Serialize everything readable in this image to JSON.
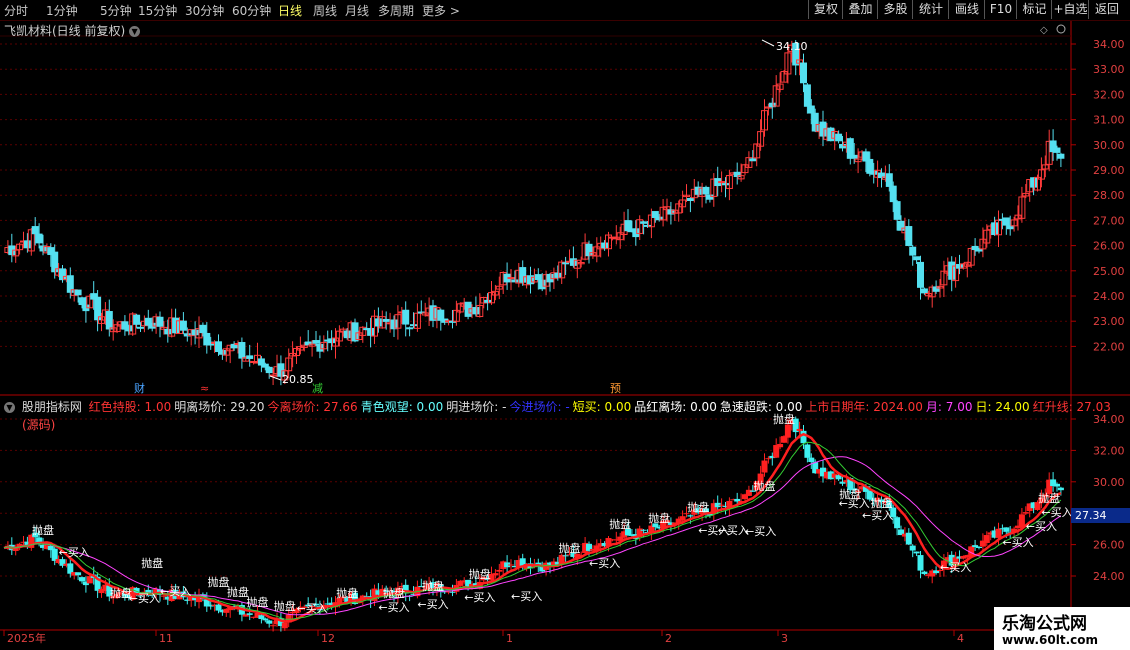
{
  "toolbar": {
    "periods": [
      "分时",
      "1分钟",
      "5分钟",
      "15分钟",
      "30分钟",
      "60分钟",
      "日线",
      "周线",
      "月线",
      "多周期",
      "更多 >"
    ],
    "active_period": "日线",
    "buttons": [
      "复权",
      "叠加",
      "多股",
      "统计",
      "画线",
      "F10",
      "标记",
      "+自选",
      "返回"
    ]
  },
  "stock": {
    "title": "飞凯材料(日线 前复权)"
  },
  "main_chart": {
    "y_ticks": [
      "34.00",
      "33.00",
      "32.00",
      "31.00",
      "30.00",
      "29.00",
      "28.00",
      "27.00",
      "26.00",
      "25.00",
      "24.00",
      "23.00",
      "22.00"
    ],
    "high_label": "34.10",
    "low_label": "20.85",
    "event_markers": [
      {
        "text": "财",
        "color": "#4aa3ff"
      },
      {
        "text": "≈",
        "color": "#ff3333"
      },
      {
        "text": "减",
        "color": "#33cc33"
      },
      {
        "text": "预",
        "color": "#ff9933"
      }
    ]
  },
  "indicator": {
    "name": "股朋指标网",
    "params": [
      {
        "label": "红色持股:",
        "value": "1.00",
        "color": "#ff3333"
      },
      {
        "label": "明离场价:",
        "value": "29.20",
        "color": "#dddddd"
      },
      {
        "label": "今离场价:",
        "value": "27.66",
        "color": "#ff3333"
      },
      {
        "label": "青色观望:",
        "value": "0.00",
        "color": "#66ffff"
      },
      {
        "label": "明进场价:",
        "value": "-",
        "color": "#dddddd"
      },
      {
        "label": "今进场价:",
        "value": "-",
        "color": "#3333ff"
      },
      {
        "label": "短买:",
        "value": "0.00",
        "color": "#ffff00"
      },
      {
        "label": "品红离场:",
        "value": "0.00",
        "color": "#ffffff"
      },
      {
        "label": "急速超跌:",
        "value": "0.00",
        "color": "#ffffff"
      },
      {
        "label": "上市日期年:",
        "value": "2024.00",
        "color": "#ff3333"
      },
      {
        "label": "月:",
        "value": "7.00",
        "color": "#ff44ff"
      },
      {
        "label": "日:",
        "value": "24.00",
        "color": "#ffff00"
      },
      {
        "label": "红升线:",
        "value": "27.03",
        "color": "#ff3333"
      }
    ],
    "source_label": "(源码)",
    "y_ticks": [
      "34.00",
      "32.00",
      "30.00",
      "28.00",
      "26.00",
      "24.00"
    ],
    "current_price": "27.34",
    "signal_sell": "抛盘",
    "signal_buy": "←买入"
  },
  "x_axis": {
    "labels": [
      "2025年",
      "11",
      "12",
      "1",
      "2",
      "3",
      "4"
    ]
  },
  "watermark": {
    "title": "乐淘公式网",
    "url": "www.60lt.com"
  },
  "colors": {
    "up": "#ff3b3b",
    "down": "#54e0f0",
    "grid": "#5a0000",
    "axis": "#b00000"
  }
}
